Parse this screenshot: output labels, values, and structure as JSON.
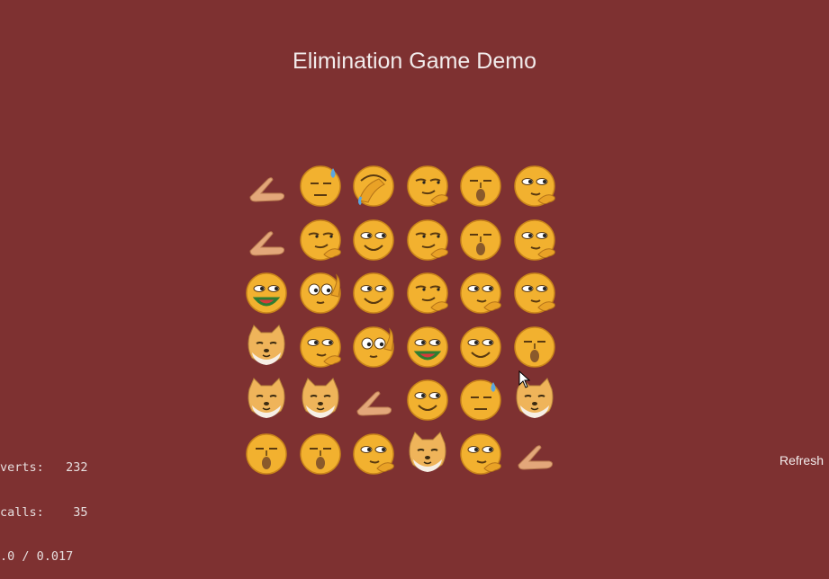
{
  "title": "Elimination Game Demo",
  "refresh_label": "Refresh",
  "stats": {
    "verts": "verts:   232",
    "calls": "calls:    35",
    "time": ".0 / 0.017"
  },
  "colors": {
    "background": "#7e3131",
    "face": "#f2b12f",
    "cat": "#efb45a"
  },
  "board": [
    [
      "hand-point-icon",
      "sweat-face-icon",
      "facepalm-face-icon",
      "smirk-face-icon",
      "whistle-face-icon",
      "thinking-face-icon"
    ],
    [
      "hand-point-icon",
      "smirk-face-icon",
      "smile-face-icon",
      "smirk-face-icon",
      "whistle-face-icon",
      "thinking-face-icon"
    ],
    [
      "watermelon-face-icon",
      "wave-face-icon",
      "smile-face-icon",
      "smirk-face-icon",
      "thinking-face-icon",
      "thinking-face-icon"
    ],
    [
      "cat-face-icon",
      "thinking-face-icon",
      "wave-face-icon",
      "watermelon-face-icon",
      "smile-face-icon",
      "whistle-face-icon"
    ],
    [
      "cat-face-icon",
      "cat-face-icon",
      "hand-point-icon",
      "smile-face-icon",
      "sweat-face-icon",
      "cat-face-icon"
    ],
    [
      "whistle-face-icon",
      "whistle-face-icon",
      "thinking-face-icon",
      "cat-face-icon",
      "thinking-face-icon",
      "hand-point-icon"
    ]
  ]
}
